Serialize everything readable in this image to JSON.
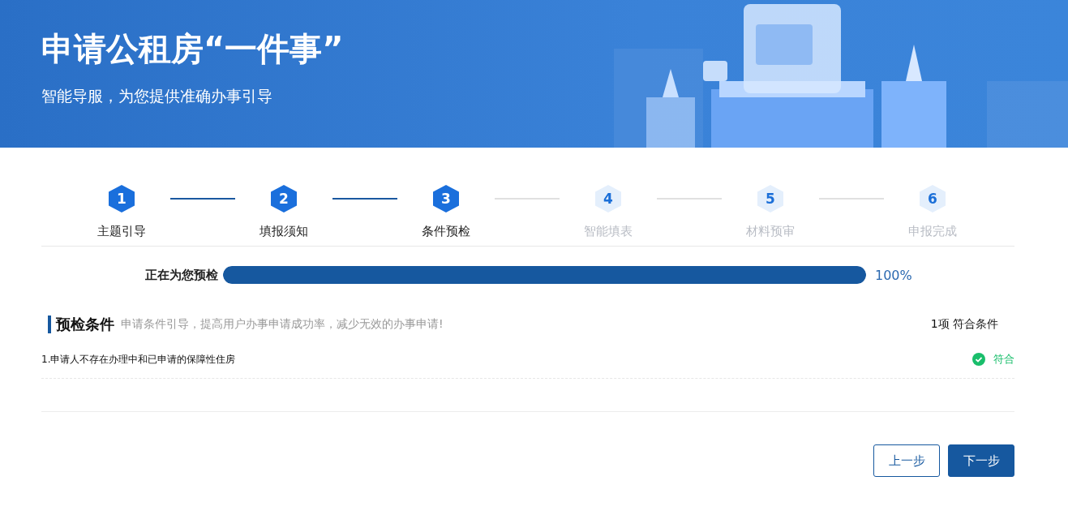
{
  "banner": {
    "title": "申请公租房“一件事”",
    "subtitle": "智能导服，为您提供准确办事引导"
  },
  "steps": [
    {
      "number": "1",
      "label": "主题引导",
      "done": true
    },
    {
      "number": "2",
      "label": "填报须知",
      "done": true
    },
    {
      "number": "3",
      "label": "条件预检",
      "done": true
    },
    {
      "number": "4",
      "label": "智能填表",
      "done": false
    },
    {
      "number": "5",
      "label": "材料预审",
      "done": false
    },
    {
      "number": "6",
      "label": "申报完成",
      "done": false
    }
  ],
  "progress": {
    "label": "正在为您预检",
    "level": 1,
    "reading": "100%"
  },
  "section": {
    "title": "预检条件",
    "hint": "申请条件引导，提高用户办事申请成功率，减少无效的办事申请!",
    "summary": "1项 符合条件"
  },
  "conditions": [
    {
      "text": "1.申请人不存在办理中和已申请的保障性住房",
      "passed": true,
      "result": "符合"
    }
  ],
  "buttons": [
    {
      "label": "上一步",
      "kind": "secondary"
    },
    {
      "label": "下一步",
      "kind": "primary"
    }
  ]
}
